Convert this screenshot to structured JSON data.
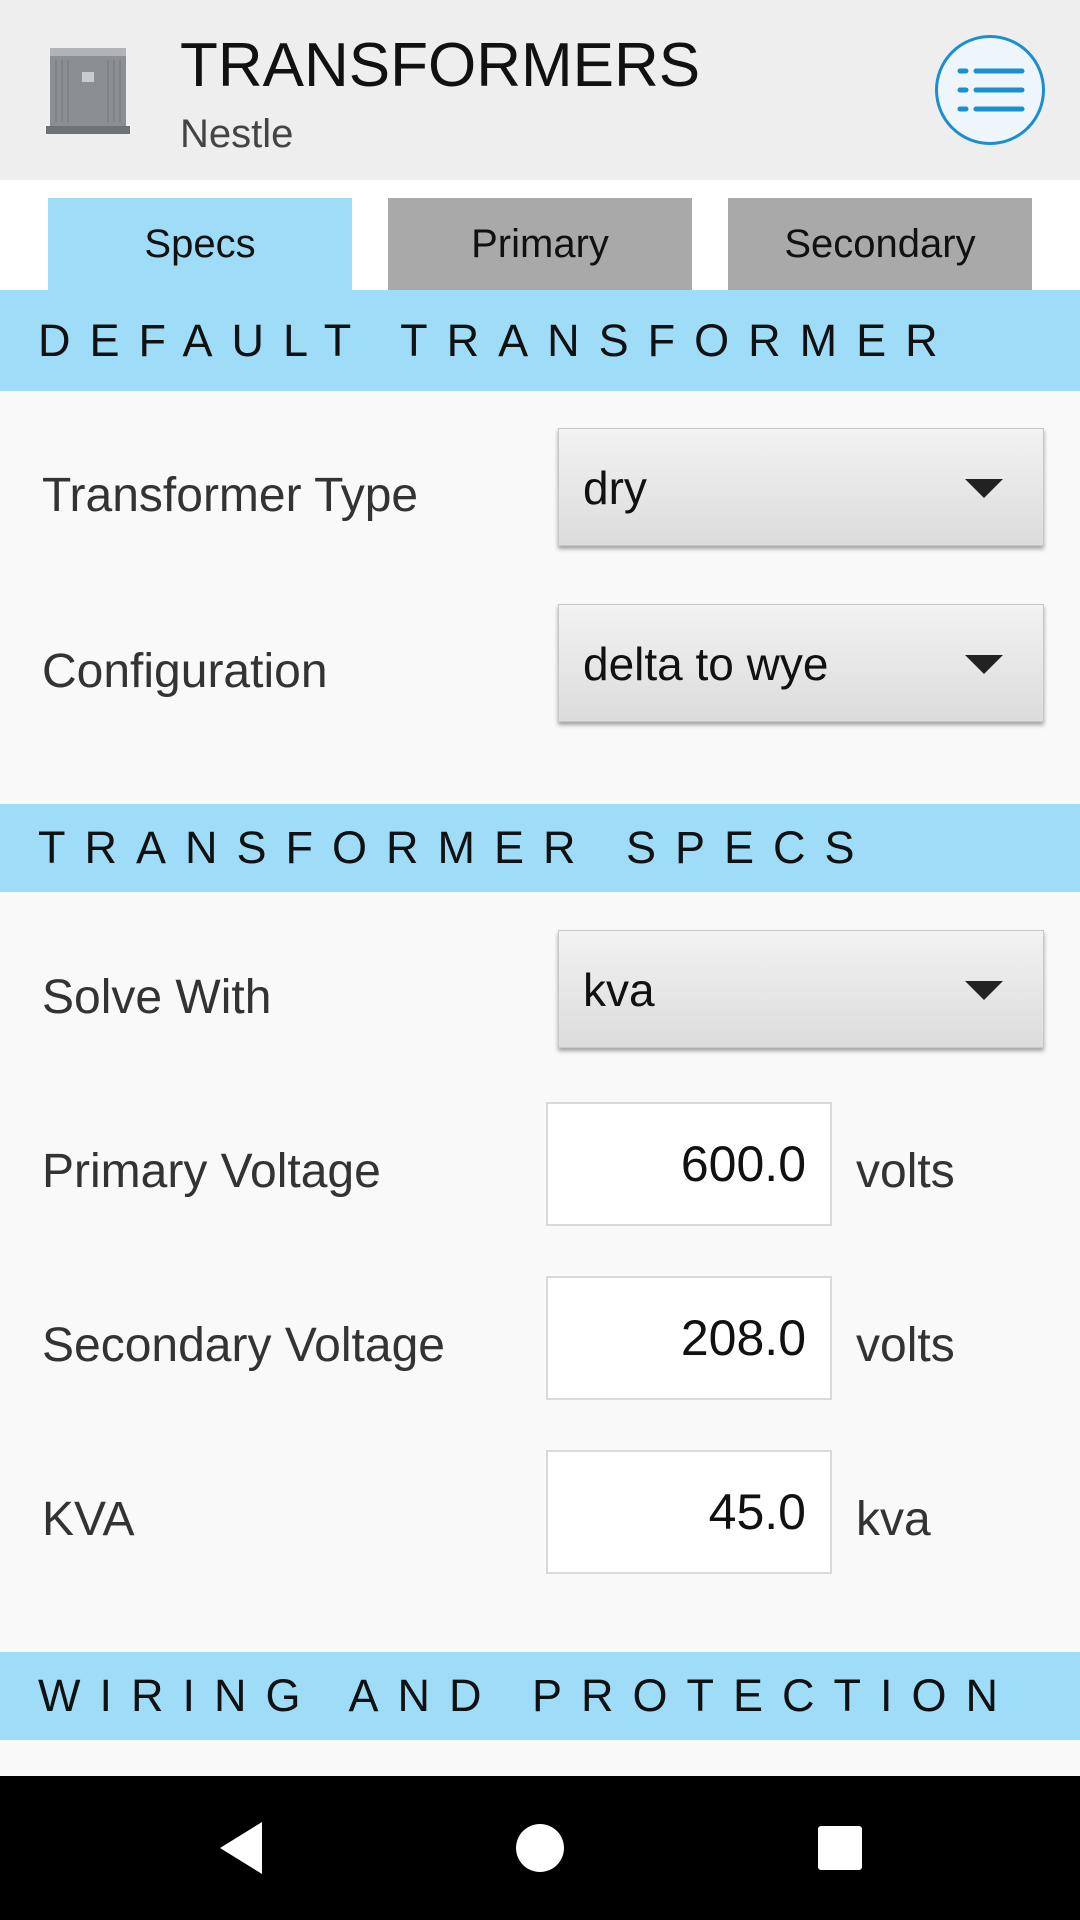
{
  "header": {
    "title": "TRANSFORMERS",
    "subtitle": "Nestle",
    "app_icon": "transformer-box-icon",
    "menu_icon": "list-menu-icon"
  },
  "tabs": [
    {
      "label": "Specs",
      "active": true
    },
    {
      "label": "Primary",
      "active": false
    },
    {
      "label": "Secondary",
      "active": false
    }
  ],
  "sections": {
    "default_transformer": "DEFAULT TRANSFORMER",
    "transformer_specs": "TRANSFORMER SPECS",
    "wiring_protection": "WIRING AND PROTECTION"
  },
  "fields": {
    "transformer_type": {
      "label": "Transformer Type",
      "value": "dry"
    },
    "configuration": {
      "label": "Configuration",
      "value": "delta to wye"
    },
    "solve_with": {
      "label": "Solve With",
      "value": "kva"
    },
    "primary_voltage": {
      "label": "Primary Voltage",
      "value": "600.0",
      "unit": "volts"
    },
    "secondary_voltage": {
      "label": "Secondary Voltage",
      "value": "208.0",
      "unit": "volts"
    },
    "kva": {
      "label": "KVA",
      "value": "45.0",
      "unit": "kva"
    }
  },
  "colors": {
    "accent": "#9edcf8",
    "menu_ring": "#1a8fd0",
    "inactive_tab": "#a9a9a9"
  },
  "nav": {
    "back_icon": "back-triangle-icon",
    "home_icon": "home-circle-icon",
    "recents_icon": "recents-square-icon"
  }
}
